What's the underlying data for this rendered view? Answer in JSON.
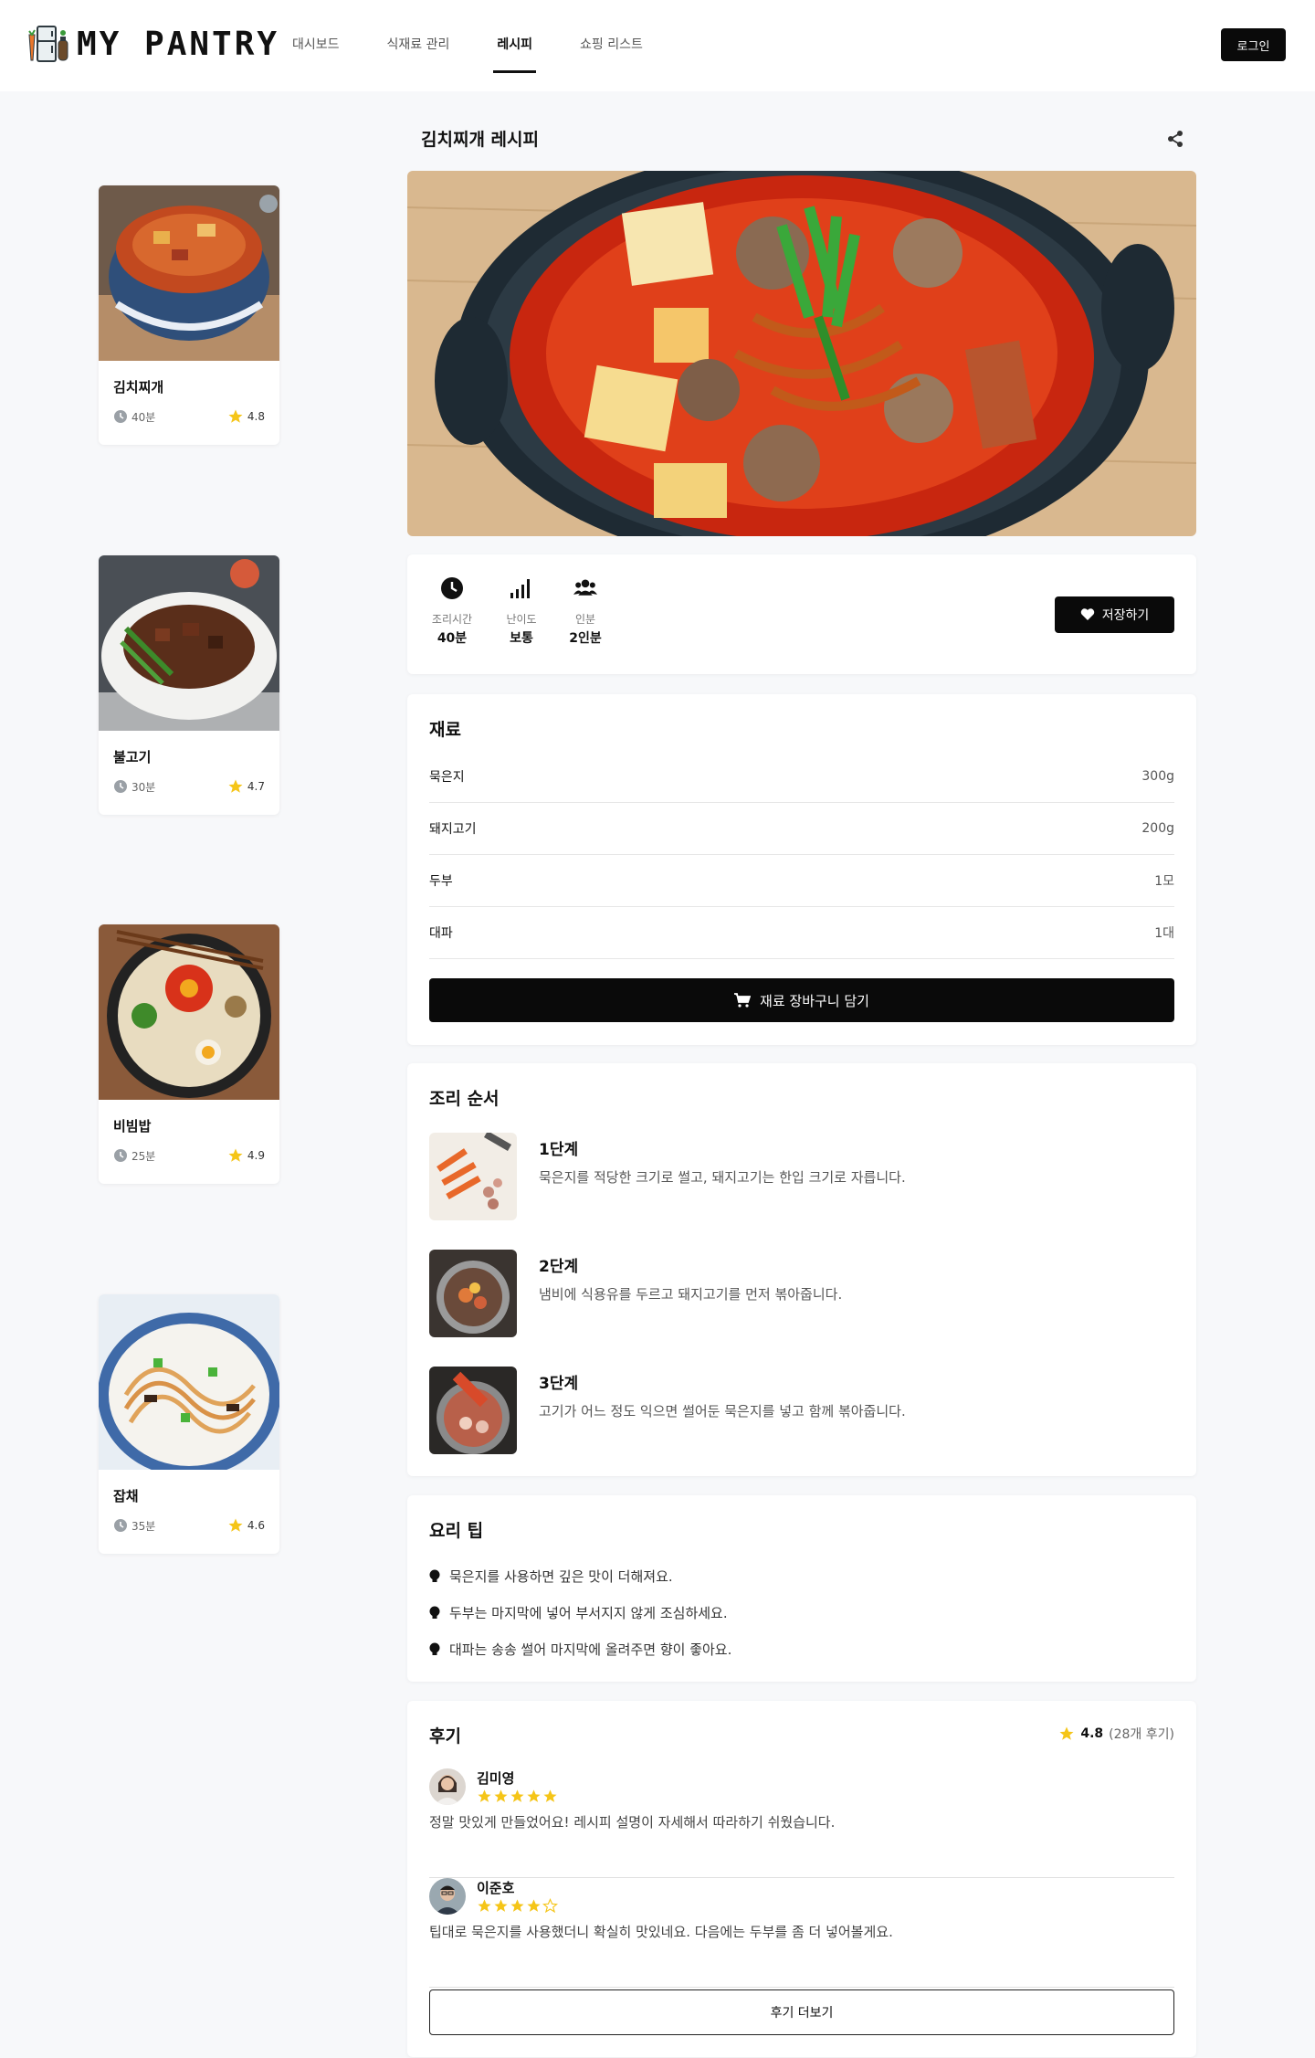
{
  "header": {
    "logo_text": "MY PANTRY",
    "nav": [
      "대시보드",
      "식재료 관리",
      "레시피",
      "쇼핑 리스트"
    ],
    "active_nav": "레시피",
    "login_label": "로그인"
  },
  "side_recipes": [
    {
      "name": "김치찌개",
      "time": "40분",
      "rating": "4.8"
    },
    {
      "name": "불고기",
      "time": "30분",
      "rating": "4.7"
    },
    {
      "name": "비빔밥",
      "time": "25분",
      "rating": "4.9"
    },
    {
      "name": "잡채",
      "time": "35분",
      "rating": "4.6"
    }
  ],
  "recipe": {
    "title": "김치찌개 레시피",
    "stats": [
      {
        "icon": "clock-icon",
        "label": "조리시간",
        "value": "40분"
      },
      {
        "icon": "signal-bars-icon",
        "label": "난이도",
        "value": "보통"
      },
      {
        "icon": "users-icon",
        "label": "인분",
        "value": "2인분"
      }
    ],
    "save_label": "저장하기"
  },
  "ingredients": {
    "title": "재료",
    "items": [
      {
        "name": "묵은지",
        "amount": "300g"
      },
      {
        "name": "돼지고기",
        "amount": "200g"
      },
      {
        "name": "두부",
        "amount": "1모"
      },
      {
        "name": "대파",
        "amount": "1대"
      }
    ],
    "cart_label": "재료 장바구니 담기"
  },
  "steps": {
    "title": "조리 순서",
    "items": [
      {
        "title": "1단계",
        "desc": "묵은지를 적당한 크기로 썰고, 돼지고기는 한입 크기로 자릅니다."
      },
      {
        "title": "2단계",
        "desc": "냄비에 식용유를 두르고 돼지고기를 먼저 볶아줍니다."
      },
      {
        "title": "3단계",
        "desc": "고기가 어느 정도 익으면 썰어둔 묵은지를 넣고 함께 볶아줍니다."
      }
    ]
  },
  "tips": {
    "title": "요리 팁",
    "items": [
      "묵은지를 사용하면 깊은 맛이 더해져요.",
      "두부는 마지막에 넣어 부서지지 않게 조심하세요.",
      "대파는 송송 썰어 마지막에 올려주면 향이 좋아요."
    ]
  },
  "reviews": {
    "title": "후기",
    "rating": "4.8",
    "count": "(28개 후기)",
    "items": [
      {
        "name": "김미영",
        "stars": 5,
        "text": "정말 맛있게 만들었어요! 레시피 설명이 자세해서 따라하기 쉬웠습니다."
      },
      {
        "name": "이준호",
        "stars": 4,
        "text": "팁대로 묵은지를 사용했더니 확실히 맛있네요. 다음에는 두부를 좀 더 넣어볼게요."
      }
    ],
    "more_label": "후기 더보기"
  },
  "colors": {
    "accent": "#0a0a0a",
    "star": "#f5c518"
  }
}
